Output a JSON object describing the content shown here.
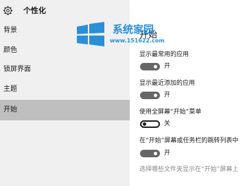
{
  "app": {
    "title": "个性化"
  },
  "sidebar": {
    "items": [
      {
        "label": "背景"
      },
      {
        "label": "颜色"
      },
      {
        "label": "锁屏界面"
      },
      {
        "label": "主题"
      },
      {
        "label": "开始",
        "active": true
      }
    ]
  },
  "main": {
    "section_title": "开始",
    "settings": [
      {
        "label": "显示最常用的应用",
        "state": "开",
        "on": true
      },
      {
        "label": "显示最近添加的应用",
        "state": "开",
        "on": true
      },
      {
        "label": "使用全屏幕“开始”菜单",
        "state": "关",
        "on": false
      },
      {
        "label": "在“开始”屏幕或任务栏的跳转列表中",
        "state": "开",
        "on": true
      }
    ],
    "choose_link": "选择哪些文件夹显示在“开始”屏幕上"
  },
  "watermark": {
    "name": "系统家园",
    "url": "www.151622.com"
  },
  "colors": {
    "toggle_on": "#666666",
    "active_nav": "#bfbfbf",
    "sidebar_bg": "#f0f0f0",
    "watermark": "#2a8fd8"
  }
}
